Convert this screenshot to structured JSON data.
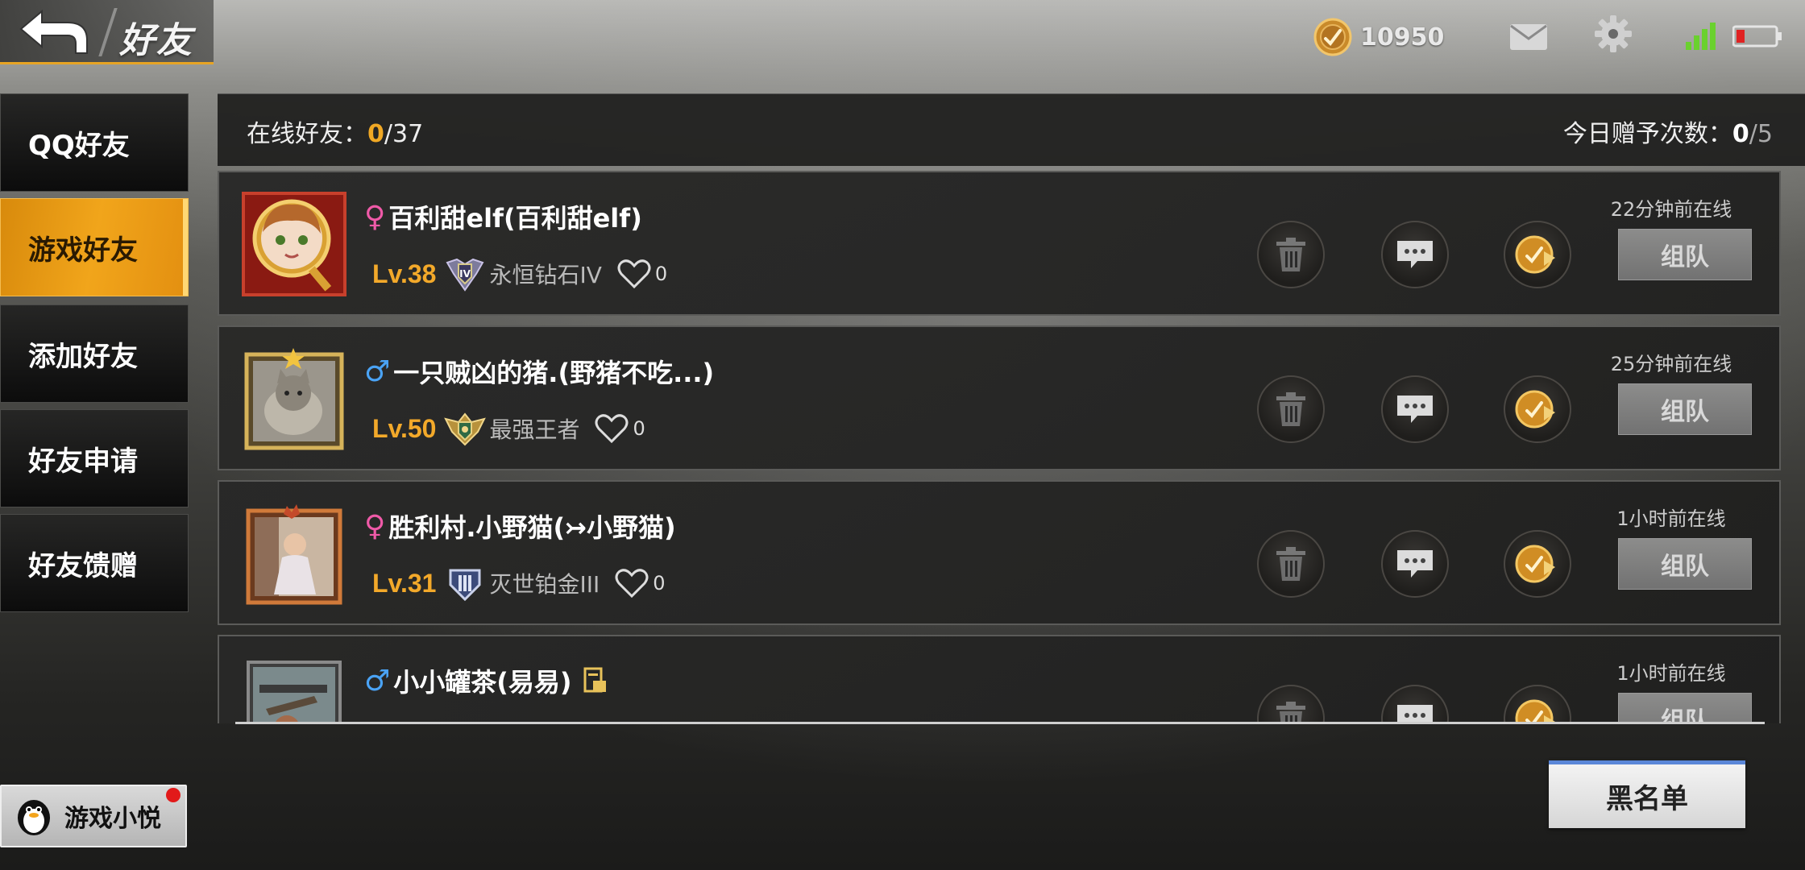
{
  "header": {
    "title": "好友",
    "coins": "10950",
    "icons": [
      "back-arrow-icon",
      "coin-icon",
      "mail-icon",
      "gear-icon",
      "signal-icon",
      "battery-icon"
    ],
    "accent": "#e7a424"
  },
  "sidebar": {
    "items": [
      {
        "label": "QQ好友",
        "active": false
      },
      {
        "label": "游戏好友",
        "active": true
      },
      {
        "label": "添加好友",
        "active": false
      },
      {
        "label": "好友申请",
        "active": false
      },
      {
        "label": "好友馈赠",
        "active": false
      }
    ],
    "assistant_label": "游戏小悦"
  },
  "stats": {
    "online_label": "在线好友：",
    "online_current": "0",
    "online_total": "/37",
    "gift_label": "今日赠予次数：",
    "gift_current": "0",
    "gift_total": "/5"
  },
  "friends": [
    {
      "gender": "♀",
      "gender_type": "female",
      "name": "百利甜elf(百利甜elf)",
      "level": "Lv.38",
      "rank": "永恒钻石IV",
      "likes": "0",
      "last_online": "22分钟前在线",
      "team_label": "组队"
    },
    {
      "gender": "♂",
      "gender_type": "male",
      "name": "一只贼凶的猪.(野猪不吃...)",
      "level": "Lv.50",
      "rank": "最强王者",
      "likes": "0",
      "last_online": "25分钟前在线",
      "team_label": "组队"
    },
    {
      "gender": "♀",
      "gender_type": "female",
      "name": "胜利村.小野猫(↣小野猫)",
      "level": "Lv.31",
      "rank": "灭世铂金III",
      "likes": "0",
      "last_online": "1小时前在线",
      "team_label": "组队"
    },
    {
      "gender": "♂",
      "gender_type": "male",
      "name": "小小罐茶(易易)",
      "level": "",
      "rank": "",
      "likes": "",
      "last_online": "1小时前在线",
      "team_label": "组队"
    }
  ],
  "blacklist_label": "黑名单"
}
